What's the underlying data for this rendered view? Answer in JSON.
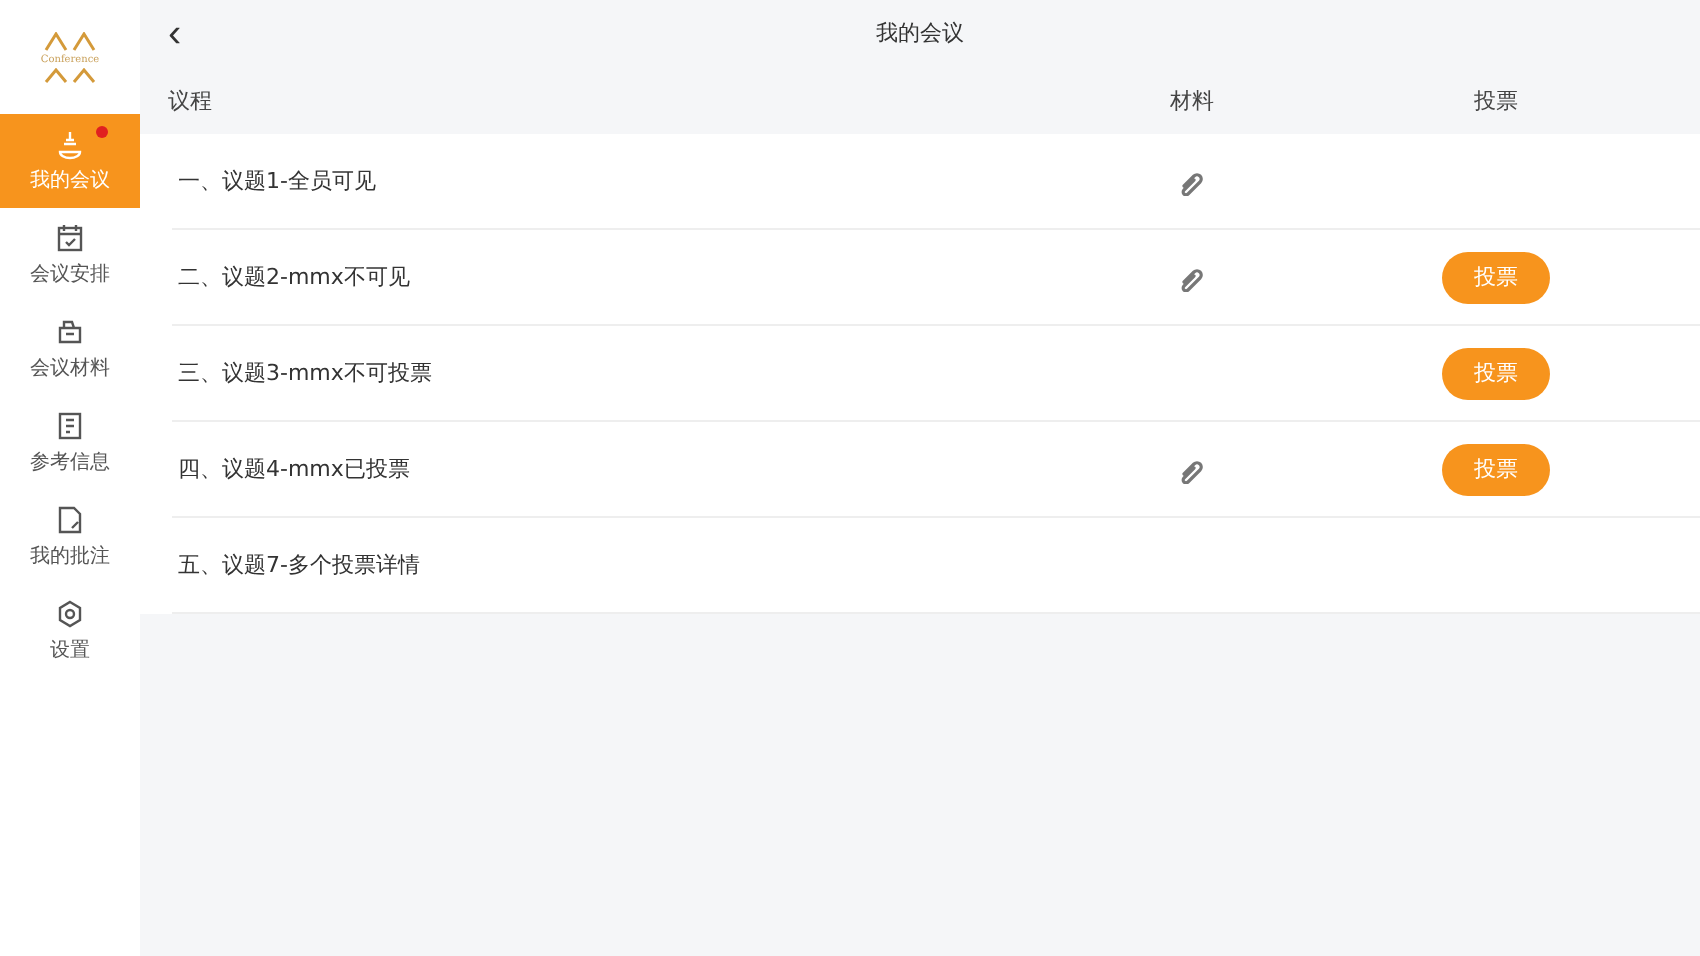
{
  "logo": {
    "text": "Conference"
  },
  "sidebar": {
    "items": [
      {
        "kind": "meeting",
        "label": "我的会议",
        "selected": true,
        "badge": true
      },
      {
        "kind": "schedule",
        "label": "会议安排",
        "selected": false,
        "badge": false
      },
      {
        "kind": "materials",
        "label": "会议材料",
        "selected": false,
        "badge": false
      },
      {
        "kind": "reference",
        "label": "参考信息",
        "selected": false,
        "badge": false
      },
      {
        "kind": "notes",
        "label": "我的批注",
        "selected": false,
        "badge": false
      },
      {
        "kind": "settings",
        "label": "设置",
        "selected": false,
        "badge": false
      }
    ]
  },
  "header": {
    "back": "‹",
    "title": "我的会议"
  },
  "table": {
    "columns": [
      "议程",
      "材料",
      "投票"
    ],
    "rows": [
      {
        "title": "一、议题1-全员可见",
        "attachment": true
      },
      {
        "title": "二、议题2-mmx不可见",
        "attachment": true,
        "vote": "投票"
      },
      {
        "title": "三、议题3-mmx不可投票",
        "attachment": false,
        "vote": "投票"
      },
      {
        "title": "四、议题4-mmx已投票",
        "attachment": true,
        "vote": "投票"
      },
      {
        "title": "五、议题7-多个投票详情",
        "attachment": false
      }
    ]
  }
}
